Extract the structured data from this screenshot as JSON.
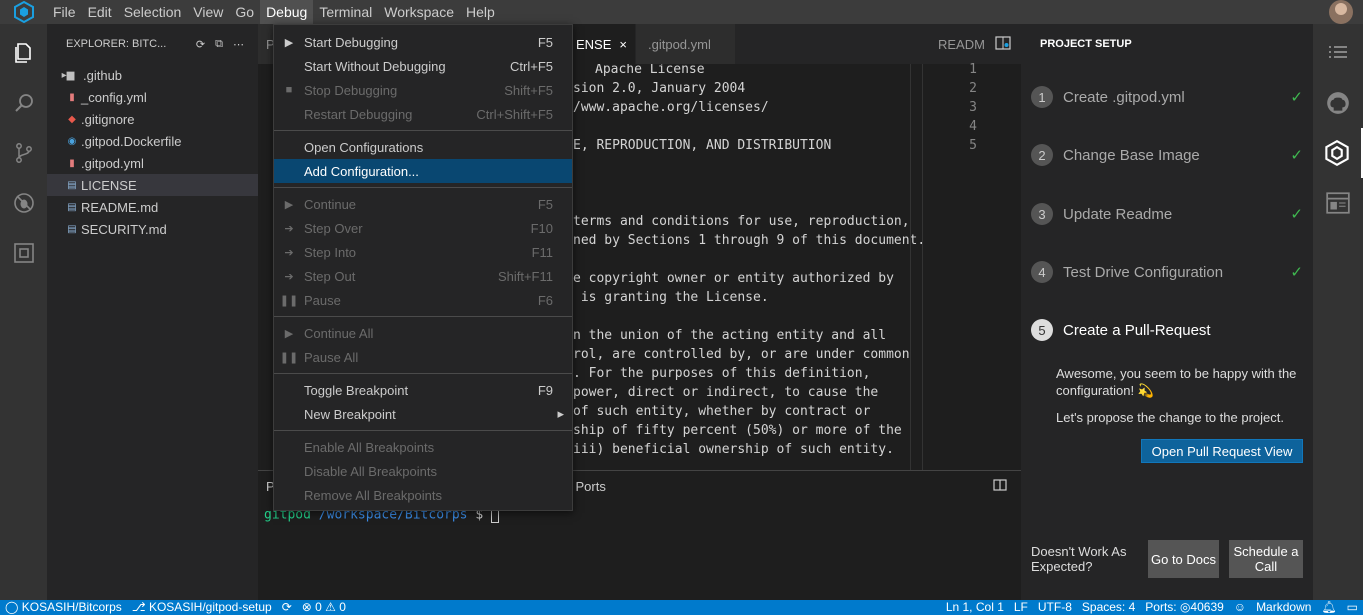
{
  "menubar": {
    "logo": "gitpod-logo-icon",
    "items": [
      "File",
      "Edit",
      "Selection",
      "View",
      "Go",
      "Debug",
      "Terminal",
      "Workspace",
      "Help"
    ],
    "active": "Debug"
  },
  "activity_bar": {
    "icons": [
      "explorer-icon",
      "search-icon",
      "source-control-icon",
      "debug-icon",
      "extensions-icon"
    ]
  },
  "explorer": {
    "title": "EXPLORER: BITC...",
    "files": [
      {
        "name": ".github",
        "icon": "folder-icon",
        "type": "folder"
      },
      {
        "name": "_config.yml",
        "icon": "yaml-file-icon",
        "type": "file"
      },
      {
        "name": ".gitignore",
        "icon": "git-file-icon",
        "type": "file"
      },
      {
        "name": ".gitpod.Dockerfile",
        "icon": "docker-file-icon",
        "type": "file"
      },
      {
        "name": ".gitpod.yml",
        "icon": "yaml-file-icon",
        "type": "file"
      },
      {
        "name": "LICENSE",
        "icon": "text-file-icon",
        "type": "file",
        "selected": true
      },
      {
        "name": "README.md",
        "icon": "text-file-icon",
        "type": "file"
      },
      {
        "name": "SECURITY.md",
        "icon": "text-file-icon",
        "type": "file"
      }
    ]
  },
  "editor": {
    "tabs": [
      {
        "label": "P"
      },
      {
        "label": "ENSE",
        "active": true
      },
      {
        "label": ".gitpod.yml"
      }
    ],
    "lines": [
      "Apache License",
      "sion 2.0, January 2004",
      "/www.apache.org/licenses/",
      "",
      "E, REPRODUCTION, AND DISTRIBUTION",
      "",
      "",
      "",
      "terms and conditions for use, reproduction,",
      "ned by Sections 1 through 9 of this document.",
      "",
      "e copyright owner or entity authorized by",
      " is granting the License.",
      "",
      "n the union of the acting entity and all",
      "rol, are controlled by, or are under common",
      ". For the purposes of this definition,",
      "power, direct or indirect, to cause the",
      "of such entity, whether by contract or",
      "ship of fifty percent (50%) or more of the",
      "iii) beneficial ownership of such entity."
    ]
  },
  "readme_editor": {
    "tab": "READM",
    "line_numbers": [
      "1",
      "2",
      "3",
      "4",
      "5"
    ]
  },
  "panel": {
    "tab_left": "P",
    "tab_ports": "n Ports",
    "prompt_user": "gitpod",
    "prompt_path": "/workspace/Bitcorps",
    "prompt_symbol": "$"
  },
  "debug_menu": {
    "groups": [
      [
        {
          "label": "Start Debugging",
          "key": "F5",
          "icon": "play-icon",
          "disabled": false
        },
        {
          "label": "Start Without Debugging",
          "key": "Ctrl+F5",
          "icon": "",
          "disabled": false
        },
        {
          "label": "Stop Debugging",
          "key": "Shift+F5",
          "icon": "stop-icon",
          "disabled": true
        },
        {
          "label": "Restart Debugging",
          "key": "Ctrl+Shift+F5",
          "icon": "",
          "disabled": true
        }
      ],
      [
        {
          "label": "Open Configurations",
          "key": "",
          "icon": "",
          "disabled": false
        },
        {
          "label": "Add Configuration...",
          "key": "",
          "icon": "",
          "disabled": false,
          "highlight": true
        }
      ],
      [
        {
          "label": "Continue",
          "key": "F5",
          "icon": "continue-icon",
          "disabled": true
        },
        {
          "label": "Step Over",
          "key": "F10",
          "icon": "step-over-icon",
          "disabled": true
        },
        {
          "label": "Step Into",
          "key": "F11",
          "icon": "step-into-icon",
          "disabled": true
        },
        {
          "label": "Step Out",
          "key": "Shift+F11",
          "icon": "step-out-icon",
          "disabled": true
        },
        {
          "label": "Pause",
          "key": "F6",
          "icon": "pause-icon",
          "disabled": true
        }
      ],
      [
        {
          "label": "Continue All",
          "key": "",
          "icon": "continue-icon",
          "disabled": true
        },
        {
          "label": "Pause All",
          "key": "",
          "icon": "pause-icon",
          "disabled": true
        }
      ],
      [
        {
          "label": "Toggle Breakpoint",
          "key": "F9",
          "icon": "",
          "disabled": false
        },
        {
          "label": "New Breakpoint",
          "key": "",
          "icon": "",
          "disabled": false,
          "submenu": true
        }
      ],
      [
        {
          "label": "Enable All Breakpoints",
          "key": "",
          "icon": "",
          "disabled": true
        },
        {
          "label": "Disable All Breakpoints",
          "key": "",
          "icon": "",
          "disabled": true
        },
        {
          "label": "Remove All Breakpoints",
          "key": "",
          "icon": "",
          "disabled": true
        }
      ]
    ]
  },
  "project_setup": {
    "title": "PROJECT SETUP",
    "steps": [
      {
        "num": "1",
        "label": "Create .gitpod.yml",
        "done": true
      },
      {
        "num": "2",
        "label": "Change Base Image",
        "done": true
      },
      {
        "num": "3",
        "label": "Update Readme",
        "done": true
      },
      {
        "num": "4",
        "label": "Test Drive Configuration",
        "done": true
      },
      {
        "num": "5",
        "label": "Create a Pull-Request",
        "done": false
      }
    ],
    "step5_text1": "Awesome, you seem to be happy with the configuration! 💫",
    "step5_text2": "Let's propose the change to the project.",
    "open_pr_button": "Open Pull Request View",
    "footer_question": "Doesn't Work As Expected?",
    "go_to_docs": "Go to Docs",
    "schedule_call": "Schedule a Call"
  },
  "right_activity": {
    "icons": [
      "outline-icon",
      "github-icon",
      "gitpod-icon",
      "preview-icon"
    ],
    "active": "gitpod-icon"
  },
  "statusbar": {
    "repo": "KOSASIH/Bitcorps",
    "branch": "KOSASIH/gitpod-setup",
    "problems": "0",
    "warnings": "0",
    "position": "Ln 1, Col 1",
    "eol": "LF",
    "encoding": "UTF-8",
    "spaces": "Spaces: 4",
    "ports": "Ports:",
    "port_num": "40639",
    "language": "Markdown"
  },
  "colors": {
    "statusbar": "#007acc",
    "menu_highlight": "#094771",
    "check": "#3fb950",
    "button": "#0e639c"
  }
}
